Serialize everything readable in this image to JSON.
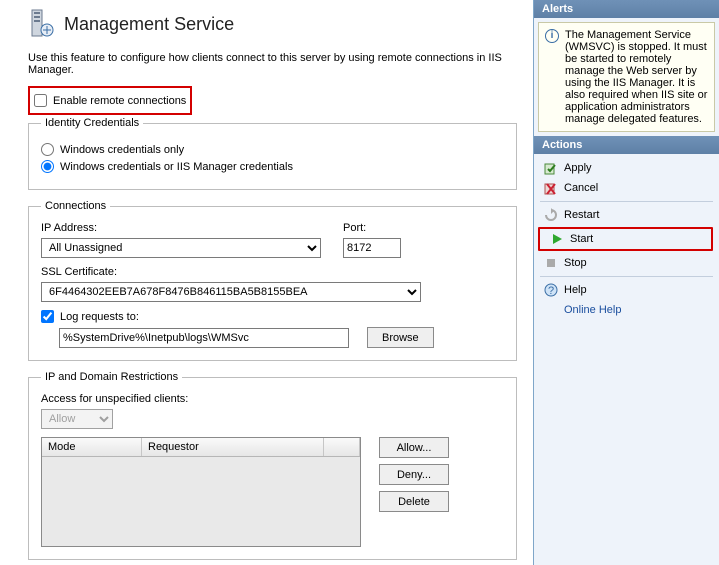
{
  "header": {
    "title": "Management Service"
  },
  "description": "Use this feature to configure how clients connect to this server by using remote connections in IIS Manager.",
  "enableRemote": {
    "label": "Enable remote connections",
    "checked": false
  },
  "identity": {
    "legend": "Identity Credentials",
    "opt1": "Windows credentials only",
    "opt2": "Windows credentials or IIS Manager credentials",
    "selected": "opt2"
  },
  "connections": {
    "legend": "Connections",
    "ipLabel": "IP Address:",
    "ipValue": "All Unassigned",
    "portLabel": "Port:",
    "portValue": "8172",
    "sslLabel": "SSL Certificate:",
    "sslValue": "6F4464302EEB7A678F8476B846115BA5B8155BEA",
    "logCheck": "Log requests to:",
    "logChecked": true,
    "logPath": "%SystemDrive%\\Inetpub\\logs\\WMSvc",
    "browse": "Browse"
  },
  "restrictions": {
    "legend": "IP and Domain Restrictions",
    "accessLabel": "Access for unspecified clients:",
    "accessValue": "Allow",
    "colMode": "Mode",
    "colReq": "Requestor",
    "allow": "Allow...",
    "deny": "Deny...",
    "delete": "Delete"
  },
  "alerts": {
    "header": "Alerts",
    "text": "The Management Service (WMSVC) is stopped. It must be started to remotely manage the Web server by using the IIS Manager. It is also required when IIS site or application administrators manage delegated features."
  },
  "actions": {
    "header": "Actions",
    "apply": "Apply",
    "cancel": "Cancel",
    "restart": "Restart",
    "start": "Start",
    "stop": "Stop",
    "help": "Help",
    "online": "Online Help"
  }
}
